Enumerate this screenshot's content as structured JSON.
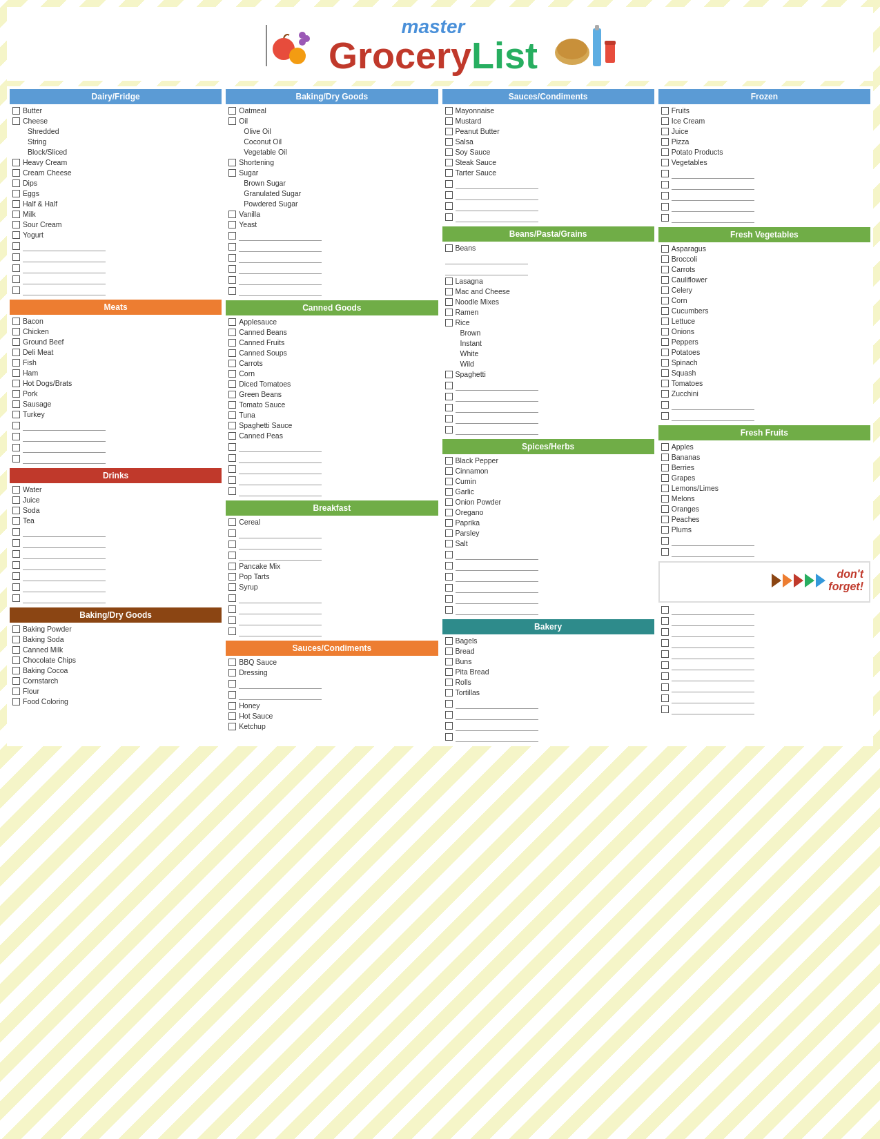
{
  "header": {
    "master": "master",
    "grocery": "Grocery",
    "list": "List"
  },
  "columns": [
    {
      "sections": [
        {
          "id": "dairy",
          "title": "Dairy/Fridge",
          "color": "blue",
          "items": [
            {
              "checked": false,
              "label": "Butter"
            },
            {
              "checked": false,
              "label": "Cheese"
            },
            {
              "sub": true,
              "label": "Shredded"
            },
            {
              "sub": true,
              "label": "String"
            },
            {
              "sub": true,
              "label": "Block/Sliced"
            },
            {
              "checked": false,
              "label": "Heavy Cream"
            },
            {
              "checked": false,
              "label": "Cream Cheese"
            },
            {
              "checked": false,
              "label": "Dips"
            },
            {
              "checked": false,
              "label": "Eggs"
            },
            {
              "checked": false,
              "label": "Half & Half"
            },
            {
              "checked": false,
              "label": "Milk"
            },
            {
              "checked": false,
              "label": "Sour Cream"
            },
            {
              "checked": false,
              "label": "Yogurt"
            },
            {
              "blank": true
            },
            {
              "blank": true
            },
            {
              "blank": true
            },
            {
              "blank": true
            },
            {
              "blank": true
            }
          ]
        },
        {
          "id": "meats",
          "title": "Meats",
          "color": "orange",
          "items": [
            {
              "checked": false,
              "label": "Bacon"
            },
            {
              "checked": false,
              "label": "Chicken"
            },
            {
              "checked": false,
              "label": "Ground Beef"
            },
            {
              "checked": false,
              "label": "Deli Meat"
            },
            {
              "checked": false,
              "label": "Fish"
            },
            {
              "checked": false,
              "label": "Ham"
            },
            {
              "checked": false,
              "label": "Hot Dogs/Brats"
            },
            {
              "checked": false,
              "label": "Pork"
            },
            {
              "checked": false,
              "label": "Sausage"
            },
            {
              "checked": false,
              "label": "Turkey"
            },
            {
              "blank": true
            },
            {
              "blank": true
            },
            {
              "blank": true
            },
            {
              "blank": true
            }
          ]
        },
        {
          "id": "drinks",
          "title": "Drinks",
          "color": "red",
          "items": [
            {
              "checked": false,
              "label": "Water"
            },
            {
              "checked": false,
              "label": "Juice"
            },
            {
              "checked": false,
              "label": "Soda"
            },
            {
              "checked": false,
              "label": "Tea"
            },
            {
              "blank": true
            },
            {
              "blank": true
            },
            {
              "blank": true
            },
            {
              "blank": true
            },
            {
              "blank": true
            },
            {
              "blank": true
            },
            {
              "blank": true
            }
          ]
        },
        {
          "id": "baking2",
          "title": "Baking/Dry Goods",
          "color": "dark-red",
          "items": [
            {
              "checked": false,
              "label": "Baking Powder"
            },
            {
              "checked": false,
              "label": "Baking Soda"
            },
            {
              "checked": false,
              "label": "Canned Milk"
            },
            {
              "checked": false,
              "label": "Chocolate Chips"
            },
            {
              "checked": false,
              "label": "Baking Cocoa"
            },
            {
              "checked": false,
              "label": "Cornstarch"
            },
            {
              "checked": false,
              "label": "Flour"
            },
            {
              "checked": false,
              "label": "Food Coloring"
            }
          ]
        }
      ]
    },
    {
      "sections": [
        {
          "id": "baking1",
          "title": "Baking/Dry Goods",
          "color": "blue",
          "items": [
            {
              "checked": false,
              "label": "Oatmeal"
            },
            {
              "checked": false,
              "label": "Oil"
            },
            {
              "sub": true,
              "label": "Olive Oil"
            },
            {
              "sub": true,
              "label": "Coconut Oil"
            },
            {
              "sub": true,
              "label": "Vegetable Oil"
            },
            {
              "checked": false,
              "label": "Shortening"
            },
            {
              "checked": false,
              "label": "Sugar"
            },
            {
              "sub": true,
              "label": "Brown Sugar"
            },
            {
              "sub": true,
              "label": "Granulated Sugar"
            },
            {
              "sub": true,
              "label": "Powdered Sugar"
            },
            {
              "checked": false,
              "label": "Vanilla"
            },
            {
              "checked": false,
              "label": "Yeast"
            },
            {
              "blank": true
            },
            {
              "blank": true
            },
            {
              "blank": true
            },
            {
              "blank": true
            },
            {
              "blank": true
            },
            {
              "blank": true
            }
          ]
        },
        {
          "id": "canned",
          "title": "Canned Goods",
          "color": "green",
          "items": [
            {
              "checked": false,
              "label": "Applesauce"
            },
            {
              "checked": false,
              "label": "Canned Beans"
            },
            {
              "checked": false,
              "label": "Canned Fruits"
            },
            {
              "checked": false,
              "label": "Canned Soups"
            },
            {
              "checked": false,
              "label": "Carrots"
            },
            {
              "checked": false,
              "label": "Corn"
            },
            {
              "checked": false,
              "label": "Diced Tomatoes"
            },
            {
              "checked": false,
              "label": "Green Beans"
            },
            {
              "checked": false,
              "label": "Tomato Sauce"
            },
            {
              "checked": false,
              "label": "Tuna"
            },
            {
              "checked": false,
              "label": "Spaghetti Sauce"
            },
            {
              "checked": false,
              "label": "Canned Peas"
            },
            {
              "blank": true
            },
            {
              "blank": true
            },
            {
              "blank": true
            },
            {
              "blank": true
            },
            {
              "blank": true
            }
          ]
        },
        {
          "id": "breakfast",
          "title": "Breakfast",
          "color": "green",
          "items": [
            {
              "checked": false,
              "label": "Cereal"
            },
            {
              "blank": true
            },
            {
              "blank": true
            },
            {
              "blank": true
            },
            {
              "checked": false,
              "label": "Pancake Mix"
            },
            {
              "checked": false,
              "label": "Pop Tarts"
            },
            {
              "checked": false,
              "label": "Syrup"
            },
            {
              "blank": true
            },
            {
              "blank": true
            },
            {
              "blank": true
            },
            {
              "blank": true
            }
          ]
        },
        {
          "id": "sauces2",
          "title": "Sauces/Condiments",
          "color": "orange",
          "items": [
            {
              "checked": false,
              "label": "BBQ Sauce"
            },
            {
              "checked": false,
              "label": "Dressing"
            },
            {
              "blank": true
            },
            {
              "blank": true
            },
            {
              "checked": false,
              "label": "Honey"
            },
            {
              "checked": false,
              "label": "Hot Sauce"
            },
            {
              "checked": false,
              "label": "Ketchup"
            }
          ]
        }
      ]
    },
    {
      "sections": [
        {
          "id": "sauces1",
          "title": "Sauces/Condiments",
          "color": "blue",
          "items": [
            {
              "checked": false,
              "label": "Mayonnaise"
            },
            {
              "checked": false,
              "label": "Mustard"
            },
            {
              "checked": false,
              "label": "Peanut Butter"
            },
            {
              "checked": false,
              "label": "Salsa"
            },
            {
              "checked": false,
              "label": "Soy Sauce"
            },
            {
              "checked": false,
              "label": "Steak Sauce"
            },
            {
              "checked": false,
              "label": "Tarter Sauce"
            },
            {
              "blank": true
            },
            {
              "blank": true
            },
            {
              "blank": true
            },
            {
              "blank": true
            }
          ]
        },
        {
          "id": "beans",
          "title": "Beans/Pasta/Grains",
          "color": "green",
          "items": [
            {
              "checked": false,
              "label": "Beans"
            },
            {
              "blank": true
            },
            {
              "blank": true
            },
            {
              "checked": false,
              "label": "Lasagna"
            },
            {
              "checked": false,
              "label": "Mac and Cheese"
            },
            {
              "checked": false,
              "label": "Noodle Mixes"
            },
            {
              "checked": false,
              "label": "Ramen"
            },
            {
              "checked": false,
              "label": "Rice"
            },
            {
              "sub": true,
              "label": "Brown"
            },
            {
              "sub": true,
              "label": "Instant"
            },
            {
              "sub": true,
              "label": "White"
            },
            {
              "sub": true,
              "label": "Wild"
            },
            {
              "checked": false,
              "label": "Spaghetti"
            },
            {
              "blank": true
            },
            {
              "blank": true
            },
            {
              "blank": true
            },
            {
              "blank": true
            },
            {
              "blank": true
            }
          ]
        },
        {
          "id": "spices",
          "title": "Spices/Herbs",
          "color": "green",
          "items": [
            {
              "checked": false,
              "label": "Black Pepper"
            },
            {
              "checked": false,
              "label": "Cinnamon"
            },
            {
              "checked": false,
              "label": "Cumin"
            },
            {
              "checked": false,
              "label": "Garlic"
            },
            {
              "checked": false,
              "label": "Onion Powder"
            },
            {
              "checked": false,
              "label": "Oregano"
            },
            {
              "checked": false,
              "label": "Paprika"
            },
            {
              "checked": false,
              "label": "Parsley"
            },
            {
              "checked": false,
              "label": "Salt"
            },
            {
              "blank": true
            },
            {
              "blank": true
            },
            {
              "blank": true
            },
            {
              "blank": true
            },
            {
              "blank": true
            },
            {
              "blank": true
            }
          ]
        },
        {
          "id": "bakery",
          "title": "Bakery",
          "color": "teal",
          "items": [
            {
              "checked": false,
              "label": "Bagels"
            },
            {
              "checked": false,
              "label": "Bread"
            },
            {
              "checked": false,
              "label": "Buns"
            },
            {
              "checked": false,
              "label": "Pita Bread"
            },
            {
              "checked": false,
              "label": "Rolls"
            },
            {
              "checked": false,
              "label": "Tortillas"
            },
            {
              "blank": true
            },
            {
              "blank": true
            },
            {
              "blank": true
            },
            {
              "blank": true
            }
          ]
        }
      ]
    },
    {
      "sections": [
        {
          "id": "frozen",
          "title": "Frozen",
          "color": "blue",
          "items": [
            {
              "checked": false,
              "label": "Fruits"
            },
            {
              "checked": false,
              "label": "Ice Cream"
            },
            {
              "checked": false,
              "label": "Juice"
            },
            {
              "checked": false,
              "label": "Pizza"
            },
            {
              "checked": false,
              "label": "Potato Products"
            },
            {
              "checked": false,
              "label": "Vegetables"
            },
            {
              "blank": true
            },
            {
              "blank": true
            },
            {
              "blank": true
            },
            {
              "blank": true
            },
            {
              "blank": true
            }
          ]
        },
        {
          "id": "fresh-veg",
          "title": "Fresh Vegetables",
          "color": "green",
          "items": [
            {
              "checked": false,
              "label": "Asparagus"
            },
            {
              "checked": false,
              "label": "Broccoli"
            },
            {
              "checked": false,
              "label": "Carrots"
            },
            {
              "checked": false,
              "label": "Cauliflower"
            },
            {
              "checked": false,
              "label": "Celery"
            },
            {
              "checked": false,
              "label": "Corn"
            },
            {
              "checked": false,
              "label": "Cucumbers"
            },
            {
              "checked": false,
              "label": "Lettuce"
            },
            {
              "checked": false,
              "label": "Onions"
            },
            {
              "checked": false,
              "label": "Peppers"
            },
            {
              "checked": false,
              "label": "Potatoes"
            },
            {
              "checked": false,
              "label": "Spinach"
            },
            {
              "checked": false,
              "label": "Squash"
            },
            {
              "checked": false,
              "label": "Tomatoes"
            },
            {
              "checked": false,
              "label": "Zucchini"
            },
            {
              "blank": true
            },
            {
              "blank": true
            }
          ]
        },
        {
          "id": "fresh-fruits",
          "title": "Fresh Fruits",
          "color": "green",
          "items": [
            {
              "checked": false,
              "label": "Apples"
            },
            {
              "checked": false,
              "label": "Bananas"
            },
            {
              "checked": false,
              "label": "Berries"
            },
            {
              "checked": false,
              "label": "Grapes"
            },
            {
              "checked": false,
              "label": "Lemons/Limes"
            },
            {
              "checked": false,
              "label": "Melons"
            },
            {
              "checked": false,
              "label": "Oranges"
            },
            {
              "checked": false,
              "label": "Peaches"
            },
            {
              "checked": false,
              "label": "Plums"
            },
            {
              "blank": true
            },
            {
              "blank": true
            }
          ]
        },
        {
          "id": "dont-forget",
          "special": "dont-forget"
        },
        {
          "id": "extra-blanks",
          "items": [
            {
              "blank": true
            },
            {
              "blank": true
            },
            {
              "blank": true
            },
            {
              "blank": true
            },
            {
              "blank": true
            },
            {
              "blank": true
            },
            {
              "blank": true
            },
            {
              "blank": true
            },
            {
              "blank": true
            },
            {
              "blank": true
            }
          ]
        }
      ]
    }
  ],
  "dont_forget": {
    "text": "don't\nforget!"
  }
}
